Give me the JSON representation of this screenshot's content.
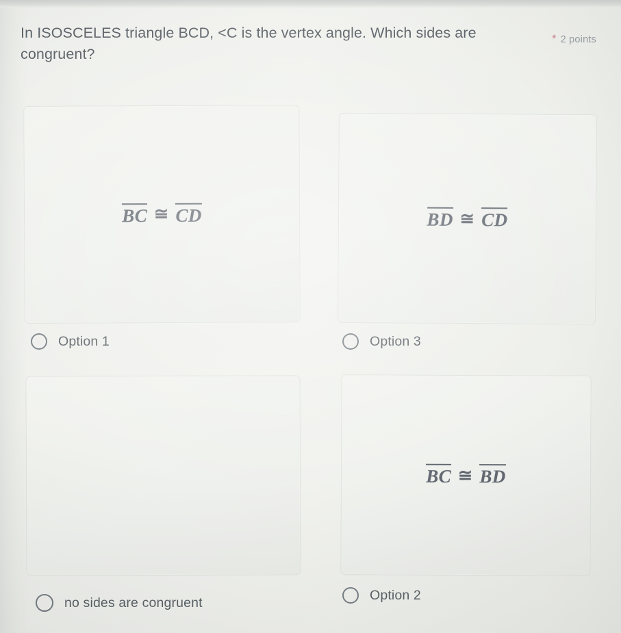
{
  "question": {
    "text": "In ISOSCELES triangle BCD, <C is the vertex angle.  Which sides are congruent?",
    "required_marker": "*",
    "points": "2 points",
    "asterisk_color": "#c77b86",
    "text_color": "#4f565c"
  },
  "options": [
    {
      "id": "option1",
      "label": "Option 1",
      "image_text": {
        "left_segment": "BC",
        "symbol": "≅",
        "right_segment": "CD"
      },
      "selected": false
    },
    {
      "id": "option3",
      "label": "Option 3",
      "image_text": {
        "left_segment": "BD",
        "symbol": "≅",
        "right_segment": "CD"
      },
      "selected": false
    },
    {
      "id": "nosides",
      "label": "no sides are congruent",
      "image_text": {
        "left_segment": "",
        "symbol": "",
        "right_segment": ""
      },
      "selected": false
    },
    {
      "id": "option2",
      "label": "Option 2",
      "image_text": {
        "left_segment": "BC",
        "symbol": "≅",
        "right_segment": "BD"
      },
      "selected": false
    }
  ],
  "icons": {
    "radio_unselected": "radio-unchecked-icon"
  }
}
